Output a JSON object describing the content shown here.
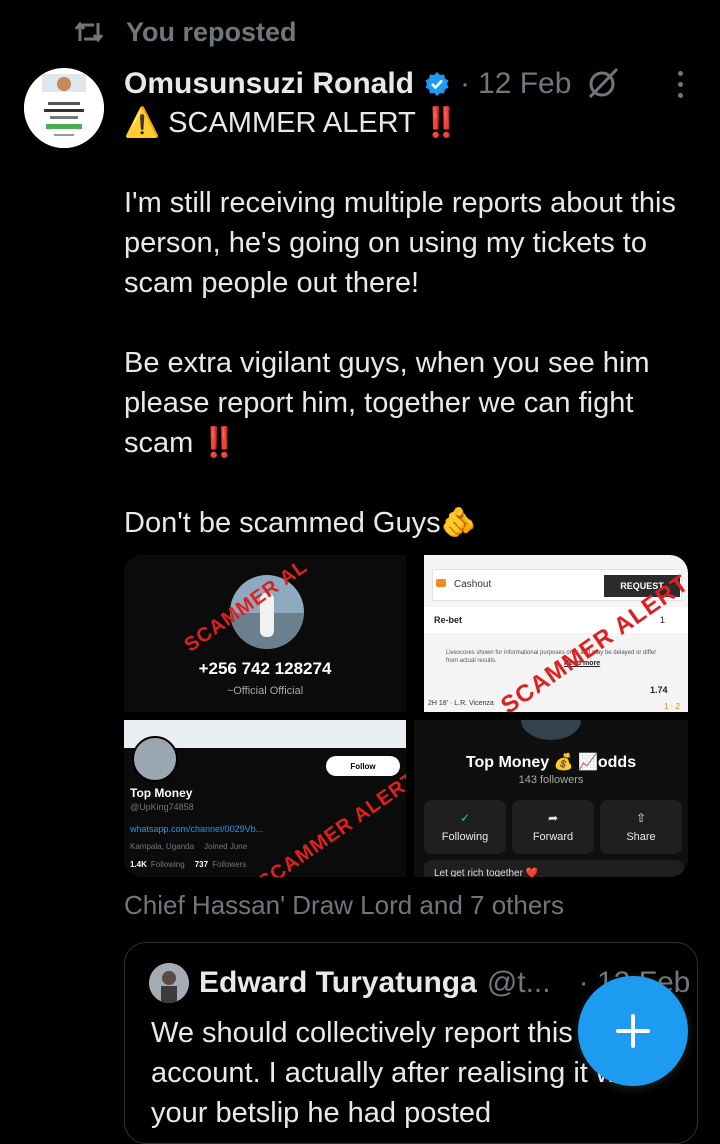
{
  "repost": {
    "label": "You reposted",
    "icon": "repost-icon"
  },
  "post": {
    "author_name": "Omusunsuzi Ronald",
    "verified_icon": "verified-badge-icon",
    "separator": "·",
    "date": "12 Feb",
    "heading": "⚠️ SCAMMER ALERT ‼️",
    "body": "I'm still receiving multiple reports about this person, he's going on using my tickets to scam people out there!\n\nBe extra vigilant guys, when you see him please report him, together we can fight scam ‼️\n\nDon't be scammed Guys🫵"
  },
  "media": {
    "stamp": "SCAMMER ALERT",
    "tile1": {
      "phone": "+256 742 128274",
      "subtitle": "~Official Official",
      "stamp": "SCAMMER AL"
    },
    "tile2": {
      "cashout": "Cashout",
      "request": "REQUEST",
      "rebet": "Re-bet",
      "rebet_count": "1",
      "notice": "Livescores shown for informational purposes only, and may be delayed or differ from actual results.",
      "read_more": "Read more",
      "odds": "1.74",
      "match": "2H 18' · L.R. Vicenza",
      "score": "1 · 2"
    },
    "tile3": {
      "name": "Top Money",
      "handle": "@UpKing74858",
      "follow": "Follow",
      "link": "whatsapp.com/channel/0029Vb...",
      "location": "Kampala, Uganda",
      "joined": "Joined June",
      "following_count": "1.4K",
      "following_label": "Following",
      "followers_count": "737",
      "followers_label": "Followers"
    },
    "tile4": {
      "name": "Top Money 💰 📈odds",
      "followers": "143 followers",
      "btn_following": "Following",
      "btn_forward": "Forward",
      "btn_share": "Share",
      "tagline": "Let get rich together ❤️"
    }
  },
  "social_context": "Chief Hassan' Draw Lord and 7 others",
  "quote": {
    "author_name": "Edward Turyatunga",
    "handle": "@t...",
    "date": "· 12 Feb",
    "text": "We should collectively report this account. I actually after realising it was your betslip he had posted"
  },
  "fab": {
    "label": "+",
    "icon": "compose-plus-icon"
  },
  "colors": {
    "accent": "#1d9bf0",
    "muted": "#71767b",
    "alert": "#e02020",
    "text": "#e7e9ea"
  }
}
